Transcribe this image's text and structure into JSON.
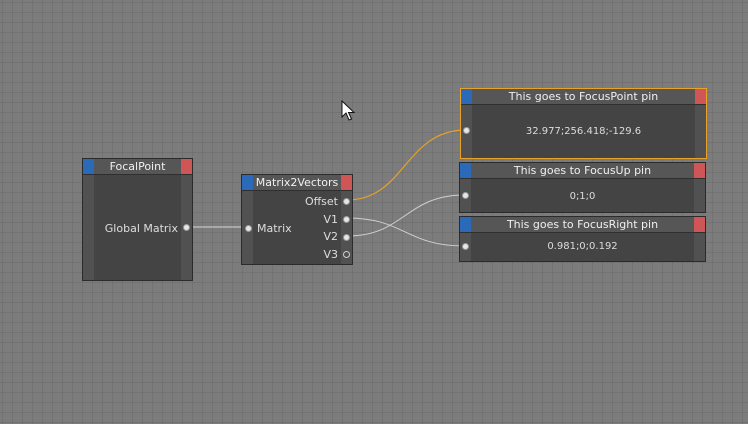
{
  "nodes": {
    "focal_point": {
      "title": "FocalPoint",
      "output_label": "Global Matrix"
    },
    "matrix2vectors": {
      "title": "Matrix2Vectors",
      "input_label": "Matrix",
      "outputs": [
        "Offset",
        "V1",
        "V2",
        "V3"
      ]
    },
    "focus_point": {
      "title": "This goes to FocusPoint pin",
      "value": "32.977;256.418;-129.6"
    },
    "focus_up": {
      "title": "This goes to FocusUp pin",
      "value": "0;1;0"
    },
    "focus_right": {
      "title": "This goes to FocusRight pin",
      "value": "0.981;0;0.192"
    }
  },
  "colors": {
    "canvas": "#7c7c7c",
    "node_body": "#444444",
    "header": "#565656",
    "cap_blue": "#2a6ab8",
    "cap_red": "#cf5656",
    "selected_wire": "#e8a22a",
    "wire": "#d0d0d0"
  },
  "icons": {
    "cursor": "mouse-pointer-icon"
  }
}
